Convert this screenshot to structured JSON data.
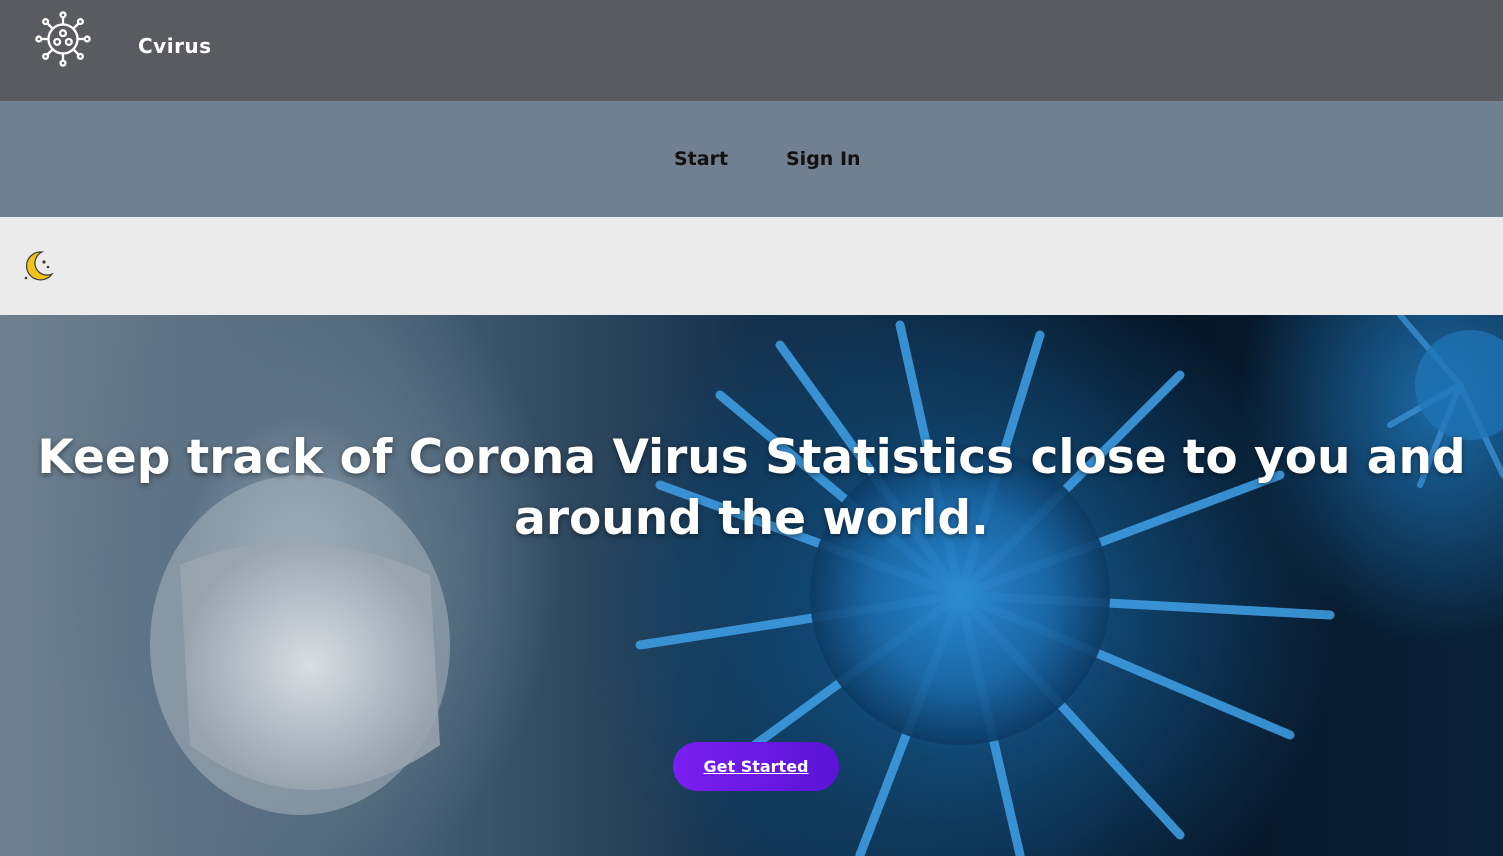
{
  "header": {
    "brand": "Cvirus",
    "logo_icon": "virus-icon"
  },
  "nav": {
    "items": [
      {
        "label": "Start"
      },
      {
        "label": "Sign In"
      }
    ]
  },
  "theme_toggle": {
    "icon": "moon-icon",
    "color": "#f2c21b"
  },
  "hero": {
    "title": "Keep track of Corona Virus Statistics close to you and around the world.",
    "cta_label": "Get Started",
    "cta_color": "#6a1be6"
  },
  "colors": {
    "topbar": "#5a5b60",
    "navbar": "#708090",
    "themebar": "#ebebeb"
  }
}
